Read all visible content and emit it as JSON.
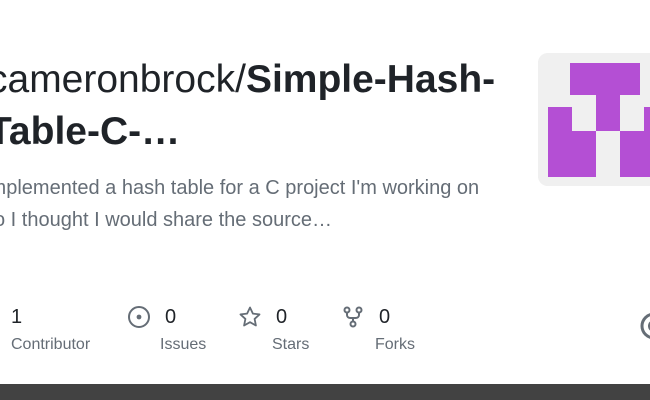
{
  "repo": {
    "owner_prefix": "cameronbrock/",
    "name": "Simple-Hash-Table-C-…",
    "description": "Implemented a hash table for a C project I'm working on so I thought I would share the source…"
  },
  "stats": {
    "contributors": {
      "value": "1",
      "label": "Contributor"
    },
    "issues": {
      "value": "0",
      "label": "Issues"
    },
    "stars": {
      "value": "0",
      "label": "Stars"
    },
    "forks": {
      "value": "0",
      "label": "Forks"
    }
  },
  "icons": {
    "issues": "issue-opened-icon",
    "stars": "star-icon",
    "forks": "repo-forked-icon",
    "right": "github-icon"
  },
  "colors": {
    "avatar": "#b44fd4",
    "avatar_bg": "#f0f0f0",
    "muted": "#656d76",
    "text": "#1f2328",
    "bottom_bar": "#424242"
  }
}
